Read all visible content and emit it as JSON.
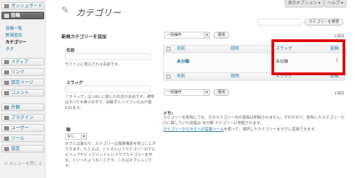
{
  "sidebar": {
    "dashboard": "ダッシュボード",
    "posts": "投稿",
    "posts_sub": [
      "投稿一覧",
      "新規追加",
      "カテゴリー",
      "タグ"
    ],
    "media": "メディア",
    "links": "リンク",
    "pages": "固定ページ",
    "comments": "コメント",
    "appearance": "外観",
    "plugins": "プラグイン",
    "users": "ユーザー",
    "tools": "ツール",
    "settings": "設定",
    "collapse": "メニューを閉じる"
  },
  "header": {
    "title": "カテゴリー",
    "screen_options": "表示オプション ▾",
    "help": "ヘルプ ▾"
  },
  "search": {
    "button": "カテゴリーを検索"
  },
  "form": {
    "heading": "新規カテゴリーを追加",
    "name_label": "名前",
    "name_desc": "サイト上に表示される名前です。",
    "slug_label": "スラッグ",
    "slug_desc": "「スラッグ」は URL に適した形式の名前です。通常はすべて半角小文字で、英数字とハイフンのみが使われます。",
    "parent_label": "親",
    "parent_value": "なし",
    "parent_desc": "タグとは異なり、カテゴリーは階層構造を持つことができます。たとえば、ジャズというカテゴリーの下にビバップやビッグバンドというサブカテゴリーを作る、といったようなことです。これはオプションです。"
  },
  "bulk": {
    "select": "一括操作",
    "apply": "適用",
    "count": "1項目"
  },
  "table": {
    "columns": [
      "名前",
      "説明",
      "スラッグ",
      "投稿"
    ],
    "rows": [
      {
        "name": "未分類",
        "description": "",
        "slug": "未分類",
        "posts": "1"
      }
    ]
  },
  "note": {
    "title": "メモ:",
    "text": "カテゴリーを削除しても、そのカテゴリー内の投稿は削除されません。そのかわり、削除したカテゴリーだけに属していた投稿は 未分類 カテゴリーに移動されます。",
    "link": "カテゴリーからタグへの変換ツール",
    "link_suffix": "を使って、選択したカテゴリーをタグに変換できます。"
  },
  "colors": {
    "highlight": "#e00000",
    "link": "#21759b"
  }
}
